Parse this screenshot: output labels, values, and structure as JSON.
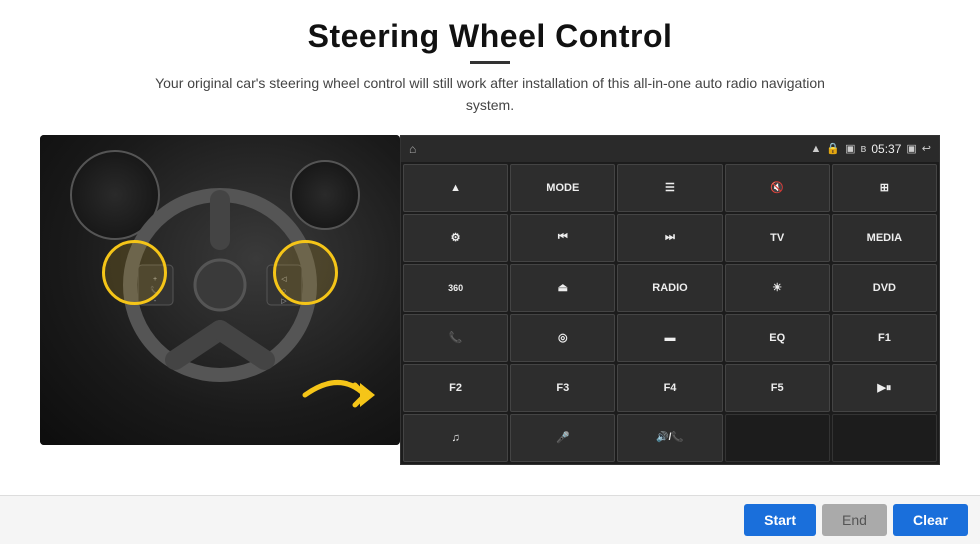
{
  "header": {
    "title": "Steering Wheel Control",
    "subtitle": "Your original car's steering wheel control will still work after installation of this all-in-one auto radio navigation system."
  },
  "status_bar": {
    "time": "05:37",
    "icons": [
      "wifi",
      "lock",
      "sim",
      "bluetooth",
      "screen-record",
      "back"
    ]
  },
  "button_grid": [
    {
      "id": "nav",
      "label": "▲",
      "type": "icon"
    },
    {
      "id": "mode",
      "label": "MODE",
      "type": "text"
    },
    {
      "id": "list",
      "label": "☰",
      "type": "icon"
    },
    {
      "id": "mute",
      "label": "🔇",
      "type": "icon"
    },
    {
      "id": "apps",
      "label": "⊞",
      "type": "icon"
    },
    {
      "id": "settings",
      "label": "⚙",
      "type": "icon"
    },
    {
      "id": "prev",
      "label": "⏮",
      "type": "icon"
    },
    {
      "id": "next",
      "label": "⏭",
      "type": "icon"
    },
    {
      "id": "tv",
      "label": "TV",
      "type": "text"
    },
    {
      "id": "media",
      "label": "MEDIA",
      "type": "text"
    },
    {
      "id": "cam360",
      "label": "360",
      "type": "text"
    },
    {
      "id": "eject",
      "label": "⏏",
      "type": "icon"
    },
    {
      "id": "radio",
      "label": "RADIO",
      "type": "text"
    },
    {
      "id": "brightness",
      "label": "☀",
      "type": "icon"
    },
    {
      "id": "dvd",
      "label": "DVD",
      "type": "text"
    },
    {
      "id": "phone",
      "label": "📞",
      "type": "icon"
    },
    {
      "id": "navi",
      "label": "◎",
      "type": "icon"
    },
    {
      "id": "screen",
      "label": "▭",
      "type": "icon"
    },
    {
      "id": "eq",
      "label": "EQ",
      "type": "text"
    },
    {
      "id": "f1",
      "label": "F1",
      "type": "text"
    },
    {
      "id": "f2",
      "label": "F2",
      "type": "text"
    },
    {
      "id": "f3",
      "label": "F3",
      "type": "text"
    },
    {
      "id": "f4",
      "label": "F4",
      "type": "text"
    },
    {
      "id": "f5",
      "label": "F5",
      "type": "text"
    },
    {
      "id": "playpause",
      "label": "▶⏸",
      "type": "icon"
    },
    {
      "id": "music",
      "label": "♫",
      "type": "icon"
    },
    {
      "id": "mic",
      "label": "🎤",
      "type": "icon"
    },
    {
      "id": "volphone",
      "label": "🔊/📞",
      "type": "icon"
    },
    {
      "id": "empty1",
      "label": "",
      "type": "empty"
    },
    {
      "id": "empty2",
      "label": "",
      "type": "empty"
    }
  ],
  "bottom_buttons": {
    "start": "Start",
    "end": "End",
    "clear": "Clear"
  },
  "colors": {
    "accent_blue": "#1a6fdb",
    "dark_bg": "#1c1c1c",
    "button_bg": "#2d2d2d",
    "status_bg": "#2a2a2a"
  }
}
